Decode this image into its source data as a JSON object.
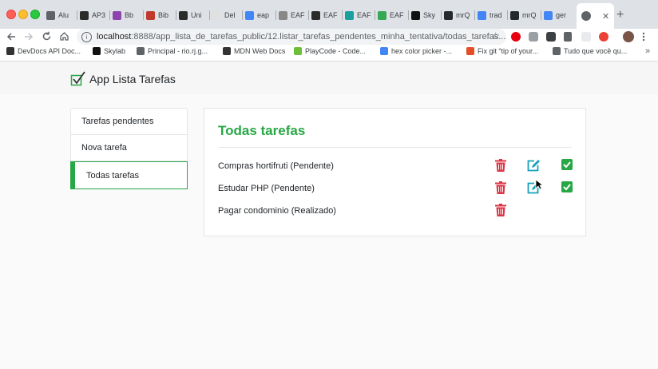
{
  "browser": {
    "tabs": [
      {
        "label": "Alu",
        "color": "#5f6368"
      },
      {
        "label": "AP3",
        "color": "#2b2b2b"
      },
      {
        "label": "Bb",
        "color": "#8e44ad"
      },
      {
        "label": "Bib",
        "color": "#c0392b"
      },
      {
        "label": "Uni",
        "color": "#2b2b2b"
      },
      {
        "label": "Del",
        "color": "#e0e0e0"
      },
      {
        "label": "eap",
        "color": "#4285f4"
      },
      {
        "label": "EAF",
        "color": "#888888"
      },
      {
        "label": "EAF",
        "color": "#2b2b2b"
      },
      {
        "label": "EAF",
        "color": "#1a9e9e"
      },
      {
        "label": "EAF",
        "color": "#34a853"
      },
      {
        "label": "Sky",
        "color": "#111111"
      },
      {
        "label": "mrQ",
        "color": "#24292e"
      },
      {
        "label": "trad",
        "color": "#4285f4"
      },
      {
        "label": "mrQ",
        "color": "#24292e"
      },
      {
        "label": "ger",
        "color": "#4285f4"
      }
    ],
    "active_tab_icon": "loading-globe-icon",
    "close_glyph": "✕",
    "new_tab_glyph": "+",
    "url_host": "localhost",
    "url_rest": ":8888/app_lista_de_tarefas_public/12.listar_tarefas_pendentes_minha_tentativa/todas_tarefas....",
    "info_glyph": "i",
    "star_glyph": "☆"
  },
  "bookmarks": [
    {
      "label": "DevDocs API Doc...",
      "color": "#333333"
    },
    {
      "label": "Skylab",
      "color": "#111111"
    },
    {
      "label": "Principal - rio.rj.g...",
      "color": "#5f6368"
    },
    {
      "label": "MDN Web Docs",
      "color": "#333333"
    },
    {
      "label": "PlayCode - Code...",
      "color": "#6dbf3b"
    },
    {
      "label": "hex color picker -...",
      "color": "#4285f4"
    },
    {
      "label": "Fix git “tip of your...",
      "color": "#e44d26"
    },
    {
      "label": "Tudo que você qu...",
      "color": "#5f6368"
    }
  ],
  "app": {
    "brand": "App Lista Tarefas",
    "accent_color": "#28a745",
    "danger_color": "#dc3545",
    "info_color": "#17a2b8"
  },
  "sidebar": {
    "items": [
      {
        "label": "Tarefas pendentes",
        "active": false
      },
      {
        "label": "Nova tarefa",
        "active": false
      },
      {
        "label": "Todas tarefas",
        "active": true
      }
    ]
  },
  "main": {
    "title": "Todas tarefas",
    "tasks": [
      {
        "text": "Compras hortifruti (Pendente)",
        "actions": [
          "delete-icon",
          "edit-icon",
          "done-check-icon"
        ]
      },
      {
        "text": "Estudar PHP (Pendente)",
        "actions": [
          "delete-icon",
          "edit-icon",
          "done-check-icon"
        ]
      },
      {
        "text": "Pagar condominio (Realizado)",
        "actions": [
          "delete-icon"
        ]
      }
    ]
  }
}
